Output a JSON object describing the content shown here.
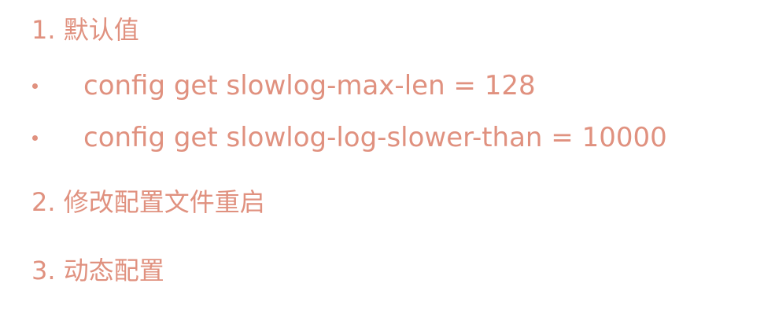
{
  "items": [
    {
      "heading": "1. 默认值",
      "bullets": [
        "config get slowlog-max-len = 128",
        "config get slowlog-log-slower-than = 10000"
      ]
    },
    {
      "heading": "2. 修改配置文件重启"
    },
    {
      "heading": "3. 动态配置"
    }
  ],
  "colors": {
    "text": "#e0917f",
    "background": "#ffffff"
  }
}
